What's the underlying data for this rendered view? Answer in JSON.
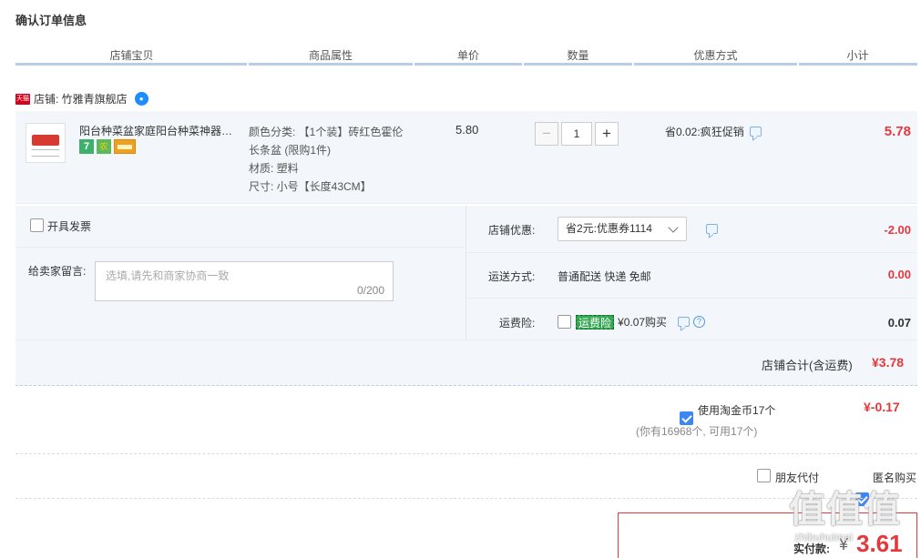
{
  "page_title": "确认订单信息",
  "columns": [
    "店铺宝贝",
    "商品属性",
    "单价",
    "数量",
    "优惠方式",
    "小计"
  ],
  "shop": {
    "badge": "天猫",
    "label": "店铺: 竹雅青旗舰店"
  },
  "item": {
    "name": "阳台种菜盆家庭阳台种菜神器长条盆",
    "badges": [
      "7",
      "农",
      "卡"
    ],
    "attr_color": "颜色分类: 【1个装】砖红色霍伦",
    "attr_color_2": "长条盆 (限购1件)",
    "attr_material": "材质: 塑料",
    "attr_size": "尺寸: 小号【长度43CM】",
    "price": "5.80",
    "quantity": "1",
    "minus": "−",
    "plus": "+",
    "promo": "省0.02:疯狂促销",
    "subtotal": "5.78"
  },
  "invoice": {
    "label": "开具发票"
  },
  "message": {
    "label": "给卖家留言:",
    "placeholder": "选填,请先和商家协商一致",
    "counter": "0/200"
  },
  "shop_discount": {
    "label": "店铺优惠:",
    "selected": "省2元:优惠券1114",
    "amount": "-2.00"
  },
  "shipping": {
    "label": "运送方式:",
    "value": "普通配送 快递 免邮",
    "amount": "0.00"
  },
  "shipping_insurance": {
    "label": "运费险:",
    "badge": "运费险",
    "price_text": "¥0.07购买",
    "help": "?",
    "amount": "0.07"
  },
  "shop_total": {
    "label": "店铺合计(含运费)",
    "amount": "¥3.78"
  },
  "taojinbi": {
    "label": "使用淘金币17个",
    "note": "(你有16968个, 可用17个)",
    "amount": "¥-0.17",
    "checked": true
  },
  "options": {
    "friend_pay": "朋友代付",
    "anonymous": "匿名购买",
    "anonymous_checked": true
  },
  "payment": {
    "label": "实付款:",
    "currency": "¥",
    "amount": "3.61"
  },
  "watermark": {
    "main": "值值值",
    "sub": "zhibuhuimai"
  },
  "colors": {
    "accent_red": "#e4393c",
    "header_line": "#b9cde4",
    "panel_bg": "#f3f7fc",
    "checkbox_blue": "#3d86f5"
  }
}
